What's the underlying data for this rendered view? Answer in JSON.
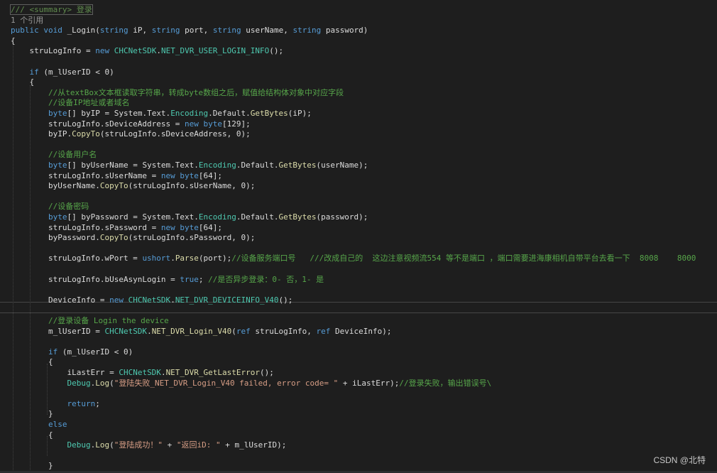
{
  "theme": {
    "background": "#1e1e1e",
    "keyword": "#569cd6",
    "type": "#4ec9b0",
    "comment": "#57a64a",
    "string": "#d69d85",
    "parameter": "#9cdcfe",
    "method": "#dcdcaa"
  },
  "watermark": "CSDN @北特",
  "code_lines": [
    [
      {
        "t": "/// <summary> 登录",
        "c": "doc"
      }
    ],
    [
      {
        "t": "1 个引用",
        "c": "codelens"
      }
    ],
    [
      {
        "t": "public",
        "c": "keyword"
      },
      {
        "t": " ",
        "c": "plain"
      },
      {
        "t": "void",
        "c": "keyword"
      },
      {
        "t": " _Login(",
        "c": "plain"
      },
      {
        "t": "string",
        "c": "keyword"
      },
      {
        "t": " iP, ",
        "c": "plain"
      },
      {
        "t": "string",
        "c": "keyword"
      },
      {
        "t": " port, ",
        "c": "plain"
      },
      {
        "t": "string",
        "c": "keyword"
      },
      {
        "t": " userName, ",
        "c": "plain"
      },
      {
        "t": "string",
        "c": "keyword"
      },
      {
        "t": " password)",
        "c": "plain"
      }
    ],
    [
      {
        "t": "{",
        "c": "plain"
      }
    ],
    [
      {
        "t": "    struLogInfo = ",
        "c": "plain"
      },
      {
        "t": "new",
        "c": "keyword"
      },
      {
        "t": " ",
        "c": "plain"
      },
      {
        "t": "CHCNetSDK",
        "c": "type"
      },
      {
        "t": ".",
        "c": "plain"
      },
      {
        "t": "NET_DVR_USER_LOGIN_INFO",
        "c": "type"
      },
      {
        "t": "();",
        "c": "plain"
      }
    ],
    [],
    [
      {
        "t": "    ",
        "c": "plain"
      },
      {
        "t": "if",
        "c": "keyword"
      },
      {
        "t": " (m_lUserID < 0)",
        "c": "plain"
      }
    ],
    [
      {
        "t": "    {",
        "c": "plain"
      }
    ],
    [
      {
        "t": "        //从textBox文本框读取字符串，转成byte数组之后，赋值给结构体对象中对应字段",
        "c": "comment"
      }
    ],
    [
      {
        "t": "        //设备IP地址或者域名",
        "c": "comment"
      }
    ],
    [
      {
        "t": "        ",
        "c": "plain"
      },
      {
        "t": "byte",
        "c": "keyword"
      },
      {
        "t": "[] byIP = System.Text.",
        "c": "plain"
      },
      {
        "t": "Encoding",
        "c": "type"
      },
      {
        "t": ".Default.",
        "c": "plain"
      },
      {
        "t": "GetBytes",
        "c": "method"
      },
      {
        "t": "(iP);",
        "c": "plain"
      }
    ],
    [
      {
        "t": "        struLogInfo.sDeviceAddress = ",
        "c": "plain"
      },
      {
        "t": "new",
        "c": "keyword"
      },
      {
        "t": " ",
        "c": "plain"
      },
      {
        "t": "byte",
        "c": "keyword"
      },
      {
        "t": "[129];",
        "c": "plain"
      }
    ],
    [
      {
        "t": "        byIP.",
        "c": "plain"
      },
      {
        "t": "CopyTo",
        "c": "method"
      },
      {
        "t": "(struLogInfo.sDeviceAddress, 0);",
        "c": "plain"
      }
    ],
    [],
    [
      {
        "t": "        //设备用户名",
        "c": "comment"
      }
    ],
    [
      {
        "t": "        ",
        "c": "plain"
      },
      {
        "t": "byte",
        "c": "keyword"
      },
      {
        "t": "[] byUserName = System.Text.",
        "c": "plain"
      },
      {
        "t": "Encoding",
        "c": "type"
      },
      {
        "t": ".Default.",
        "c": "plain"
      },
      {
        "t": "GetBytes",
        "c": "method"
      },
      {
        "t": "(userName);",
        "c": "plain"
      }
    ],
    [
      {
        "t": "        struLogInfo.sUserName = ",
        "c": "plain"
      },
      {
        "t": "new",
        "c": "keyword"
      },
      {
        "t": " ",
        "c": "plain"
      },
      {
        "t": "byte",
        "c": "keyword"
      },
      {
        "t": "[64];",
        "c": "plain"
      }
    ],
    [
      {
        "t": "        byUserName.",
        "c": "plain"
      },
      {
        "t": "CopyTo",
        "c": "method"
      },
      {
        "t": "(struLogInfo.sUserName, 0);",
        "c": "plain"
      }
    ],
    [],
    [
      {
        "t": "        //设备密码",
        "c": "comment"
      }
    ],
    [
      {
        "t": "        ",
        "c": "plain"
      },
      {
        "t": "byte",
        "c": "keyword"
      },
      {
        "t": "[] byPassword = System.Text.",
        "c": "plain"
      },
      {
        "t": "Encoding",
        "c": "type"
      },
      {
        "t": ".Default.",
        "c": "plain"
      },
      {
        "t": "GetBytes",
        "c": "method"
      },
      {
        "t": "(password);",
        "c": "plain"
      }
    ],
    [
      {
        "t": "        struLogInfo.sPassword = ",
        "c": "plain"
      },
      {
        "t": "new",
        "c": "keyword"
      },
      {
        "t": " ",
        "c": "plain"
      },
      {
        "t": "byte",
        "c": "keyword"
      },
      {
        "t": "[64];",
        "c": "plain"
      }
    ],
    [
      {
        "t": "        byPassword.",
        "c": "plain"
      },
      {
        "t": "CopyTo",
        "c": "method"
      },
      {
        "t": "(struLogInfo.sPassword, 0);",
        "c": "plain"
      }
    ],
    [],
    [
      {
        "t": "        struLogInfo.wPort = ",
        "c": "plain"
      },
      {
        "t": "ushort",
        "c": "keyword"
      },
      {
        "t": ".",
        "c": "plain"
      },
      {
        "t": "Parse",
        "c": "method"
      },
      {
        "t": "(port);",
        "c": "plain"
      },
      {
        "t": "//设备服务端口号   ///改成自己的  这边注意视频流554 等不是端口 ，端口需要进海康相机自带平台去看一下  8008    8000",
        "c": "comment"
      }
    ],
    [],
    [
      {
        "t": "        struLogInfo.bUseAsynLogin = ",
        "c": "plain"
      },
      {
        "t": "true",
        "c": "keyword"
      },
      {
        "t": "; ",
        "c": "plain"
      },
      {
        "t": "//是否异步登录：0- 否，1- 是",
        "c": "comment"
      }
    ],
    [],
    [
      {
        "t": "        DeviceInfo = ",
        "c": "plain"
      },
      {
        "t": "new",
        "c": "keyword"
      },
      {
        "t": " ",
        "c": "plain"
      },
      {
        "t": "CHCNetSDK",
        "c": "type"
      },
      {
        "t": ".",
        "c": "plain"
      },
      {
        "t": "NET_DVR_DEVICEINFO_V40",
        "c": "type"
      },
      {
        "t": "();",
        "c": "plain"
      }
    ],
    [],
    [
      {
        "t": "        //登录设备 Login the device",
        "c": "comment"
      }
    ],
    [
      {
        "t": "        m_lUserID = ",
        "c": "plain"
      },
      {
        "t": "CHCNetSDK",
        "c": "type"
      },
      {
        "t": ".",
        "c": "plain"
      },
      {
        "t": "NET_DVR_Login_V40",
        "c": "method"
      },
      {
        "t": "(",
        "c": "plain"
      },
      {
        "t": "ref",
        "c": "keyword"
      },
      {
        "t": " struLogInfo, ",
        "c": "plain"
      },
      {
        "t": "ref",
        "c": "keyword"
      },
      {
        "t": " DeviceInfo);",
        "c": "plain"
      }
    ],
    [],
    [
      {
        "t": "        ",
        "c": "plain"
      },
      {
        "t": "if",
        "c": "keyword"
      },
      {
        "t": " (m_lUserID < 0)",
        "c": "plain"
      }
    ],
    [
      {
        "t": "        {",
        "c": "plain"
      }
    ],
    [
      {
        "t": "            iLastErr = ",
        "c": "plain"
      },
      {
        "t": "CHCNetSDK",
        "c": "type"
      },
      {
        "t": ".",
        "c": "plain"
      },
      {
        "t": "NET_DVR_GetLastError",
        "c": "method"
      },
      {
        "t": "();",
        "c": "plain"
      }
    ],
    [
      {
        "t": "            ",
        "c": "plain"
      },
      {
        "t": "Debug",
        "c": "type"
      },
      {
        "t": ".",
        "c": "plain"
      },
      {
        "t": "Log",
        "c": "method"
      },
      {
        "t": "(",
        "c": "plain"
      },
      {
        "t": "\"登陆失败_NET_DVR_Login_V40 failed, error code= \"",
        "c": "string"
      },
      {
        "t": " + iLastErr);",
        "c": "plain"
      },
      {
        "t": "//登录失败，输出错误号\\",
        "c": "comment"
      }
    ],
    [],
    [
      {
        "t": "            ",
        "c": "plain"
      },
      {
        "t": "return",
        "c": "keyword"
      },
      {
        "t": ";",
        "c": "plain"
      }
    ],
    [
      {
        "t": "        }",
        "c": "plain"
      }
    ],
    [
      {
        "t": "        ",
        "c": "plain"
      },
      {
        "t": "else",
        "c": "keyword"
      }
    ],
    [
      {
        "t": "        {",
        "c": "plain"
      }
    ],
    [
      {
        "t": "            ",
        "c": "plain"
      },
      {
        "t": "Debug",
        "c": "type"
      },
      {
        "t": ".",
        "c": "plain"
      },
      {
        "t": "Log",
        "c": "method"
      },
      {
        "t": "(",
        "c": "plain"
      },
      {
        "t": "\"登陆成功！\"",
        "c": "string"
      },
      {
        "t": " + ",
        "c": "plain"
      },
      {
        "t": "\"返回iD: \"",
        "c": "string"
      },
      {
        "t": " + m_lUserID);",
        "c": "plain"
      }
    ],
    [],
    [
      {
        "t": "        }",
        "c": "plain"
      }
    ]
  ]
}
